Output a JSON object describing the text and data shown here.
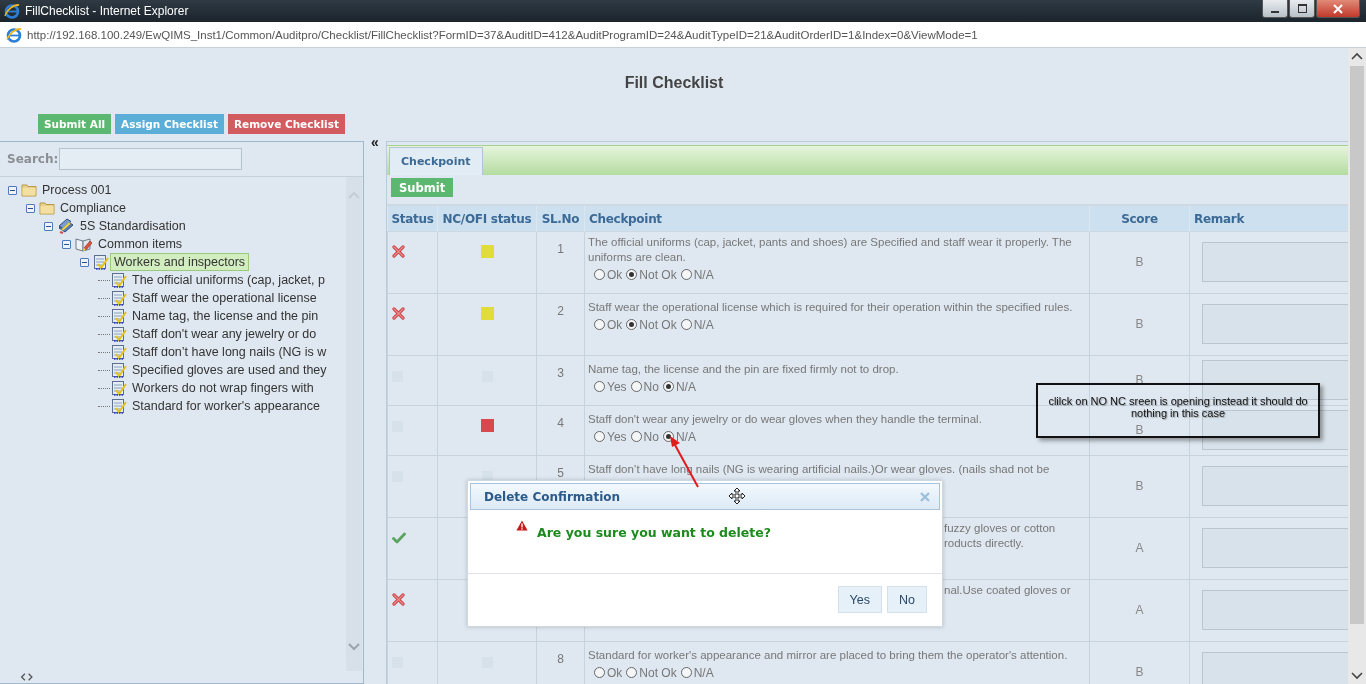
{
  "window": {
    "title": "FillChecklist - Internet Explorer"
  },
  "address_bar": {
    "url": "http://192.168.100.249/EwQIMS_Inst1/Common/Auditpro/Checklist/FillChecklist?FormID=37&AuditID=412&AuditProgramID=24&AuditTypeID=21&AuditOrderID=1&Index=0&ViewMode=1"
  },
  "page": {
    "title": "Fill Checklist"
  },
  "actions": [
    {
      "label": "Submit All",
      "kind": "success"
    },
    {
      "label": "Assign Checklist",
      "kind": "info"
    },
    {
      "label": "Remove Checklist",
      "kind": "danger"
    }
  ],
  "sidebar": {
    "search": {
      "label": "Search:"
    },
    "collapse_toggle": "«",
    "tree": [
      {
        "label": "Process 001",
        "kind": "folder",
        "expanded": true,
        "selected": false,
        "children": [
          {
            "label": "Compliance",
            "kind": "folder",
            "expanded": true,
            "selected": false,
            "children": [
              {
                "label": "5S Standardisation",
                "kind": "binder",
                "expanded": true,
                "selected": false,
                "children": [
                  {
                    "label": "Common items",
                    "kind": "book",
                    "expanded": true,
                    "selected": false,
                    "children": [
                      {
                        "label": "Workers and inspectors",
                        "kind": "checklist",
                        "expanded": true,
                        "selected": true,
                        "children": [
                          {
                            "label": "The official uniforms (cap, jacket, p",
                            "kind": "checklist",
                            "selected": false
                          },
                          {
                            "label": "Staff wear the operational license",
                            "kind": "checklist",
                            "selected": false
                          },
                          {
                            "label": "Name tag, the license and the pin",
                            "kind": "checklist",
                            "selected": false
                          },
                          {
                            "label": "Staff don't wear any jewelry or do",
                            "kind": "checklist",
                            "selected": false
                          },
                          {
                            "label": "Staff don’t have long nails (NG is w",
                            "kind": "checklist",
                            "selected": false
                          },
                          {
                            "label": "Specified gloves are used and they",
                            "kind": "checklist",
                            "selected": false
                          },
                          {
                            "label": "Workers do not wrap fingers with",
                            "kind": "checklist",
                            "selected": false
                          },
                          {
                            "label": "Standard for worker's appearance",
                            "kind": "checklist",
                            "selected": false
                          }
                        ]
                      }
                    ]
                  }
                ]
              }
            ]
          }
        ]
      }
    ]
  },
  "tabs": [
    {
      "label": "Checkpoint",
      "selected": true
    }
  ],
  "submit_button": {
    "label": "Submit"
  },
  "table": {
    "columns": [
      "Status",
      "NC/OFI status",
      "SL.No",
      "Checkpoint",
      "Score",
      "Remark"
    ],
    "rows": [
      {
        "status": {
          "kind": "fail"
        },
        "nc": {
          "kind": "mark",
          "color": "#e0dc3a"
        },
        "sl": "1",
        "checkpoint": "The official uniforms (cap, jacket, pants and shoes) are Specified and staff wear it properly. The uniforms are clean.",
        "options": [
          {
            "label": "Ok",
            "selected": false
          },
          {
            "label": "Not Ok",
            "selected": true
          },
          {
            "label": "N/A",
            "selected": false
          }
        ],
        "score": "B"
      },
      {
        "status": {
          "kind": "fail"
        },
        "nc": {
          "kind": "mark",
          "color": "#e0dc3a"
        },
        "sl": "2",
        "checkpoint": "Staff wear the operational license which is required for their operation within the specified rules.",
        "options": [
          {
            "label": "Ok",
            "selected": false
          },
          {
            "label": "Not Ok",
            "selected": true
          },
          {
            "label": "N/A",
            "selected": false
          }
        ],
        "score": "B"
      },
      {
        "status": {
          "kind": "none"
        },
        "nc": {
          "kind": "empty"
        },
        "sl": "3",
        "checkpoint": "Name tag, the license and the pin are fixed firmly not to drop.",
        "options": [
          {
            "label": "Yes",
            "selected": false
          },
          {
            "label": "No",
            "selected": false
          },
          {
            "label": "N/A",
            "selected": true
          }
        ],
        "score": "B"
      },
      {
        "status": {
          "kind": "none"
        },
        "nc": {
          "kind": "mark",
          "color": "#d9474f"
        },
        "sl": "4",
        "checkpoint": "Staff don't wear any jewelry or do wear gloves when they handle the terminal.",
        "options": [
          {
            "label": "Yes",
            "selected": false
          },
          {
            "label": "No",
            "selected": false
          },
          {
            "label": "N/A",
            "selected": true
          }
        ],
        "score": "B"
      },
      {
        "status": {
          "kind": "none"
        },
        "nc": {
          "kind": "empty"
        },
        "sl": "5",
        "checkpoint": "Staff don’t have long nails (NG is wearing artificial nails.)Or wear gloves. (nails shad not be",
        "score": "B"
      },
      {
        "status": {
          "kind": "pass"
        },
        "checkpoint_fragments": [
          "fuzzy gloves or cotton",
          "roducts directly."
        ],
        "score": "A"
      },
      {
        "status": {
          "kind": "fail"
        },
        "checkpoint_fragments": [
          "nal.Use coated gloves or"
        ],
        "score": "A"
      },
      {
        "status": {
          "kind": "none"
        },
        "nc": {
          "kind": "empty"
        },
        "sl": "8",
        "checkpoint": "Standard for worker's appearance and mirror are placed to bring them the operator's attention.",
        "options": [
          {
            "label": "Ok",
            "selected": false
          },
          {
            "label": "Not Ok",
            "selected": false
          },
          {
            "label": "N/A",
            "selected": false
          }
        ],
        "score": "B"
      }
    ]
  },
  "dialog": {
    "title": "Delete Confirmation",
    "message": "Are you sure you want to delete?",
    "buttons": [
      "Yes",
      "No"
    ]
  },
  "annotation": {
    "text": "clilck on NO NC sreen is opening instead it should do nothing in this case"
  }
}
